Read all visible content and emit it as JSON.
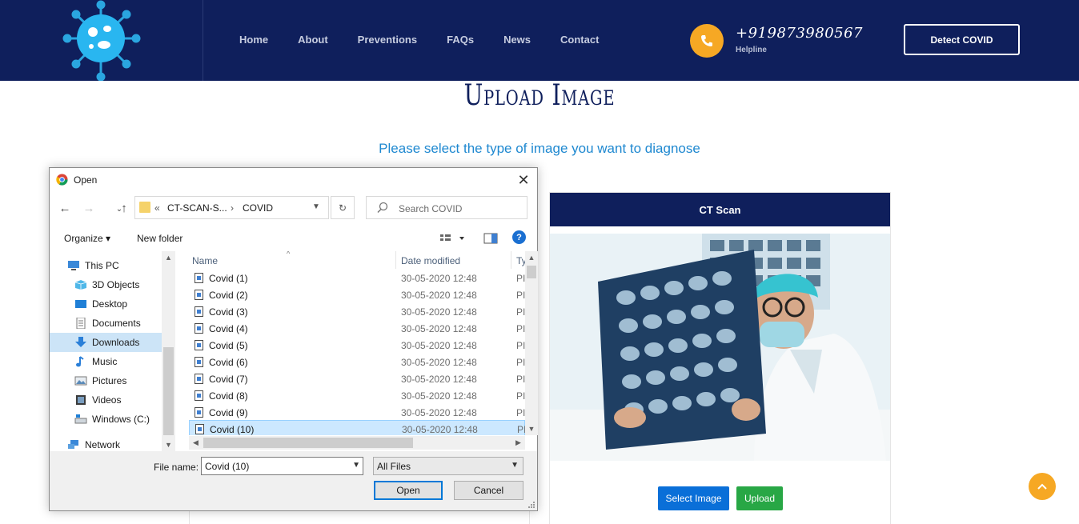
{
  "header": {
    "nav": [
      "Home",
      "About",
      "Preventions",
      "FAQs",
      "News",
      "Contact"
    ],
    "phone_number": "+919873980567",
    "phone_label": "Helpline",
    "cta_label": "Detect COVID"
  },
  "main": {
    "title": "Upload Image",
    "subtitle": "Please select the type of image you want to diagnose",
    "ct_card": {
      "title": "CT Scan",
      "select_label": "Select Image",
      "upload_label": "Upload"
    }
  },
  "dialog": {
    "title": "Open",
    "path": [
      "CT-SCAN-S...",
      "COVID"
    ],
    "path_prefix": "«",
    "search_placeholder": "Search COVID",
    "toolbar": {
      "organize": "Organize ▾",
      "new_folder": "New folder"
    },
    "nav_pane": [
      {
        "label": "This PC",
        "icon": "pc-icon",
        "indent": false,
        "selected": false
      },
      {
        "label": "3D Objects",
        "icon": "3d-objects-icon",
        "indent": true,
        "selected": false
      },
      {
        "label": "Desktop",
        "icon": "desktop-icon",
        "indent": true,
        "selected": false
      },
      {
        "label": "Documents",
        "icon": "documents-icon",
        "indent": true,
        "selected": false
      },
      {
        "label": "Downloads",
        "icon": "downloads-icon",
        "indent": true,
        "selected": true
      },
      {
        "label": "Music",
        "icon": "music-icon",
        "indent": true,
        "selected": false
      },
      {
        "label": "Pictures",
        "icon": "pictures-icon",
        "indent": true,
        "selected": false
      },
      {
        "label": "Videos",
        "icon": "videos-icon",
        "indent": true,
        "selected": false
      },
      {
        "label": "Windows (C:)",
        "icon": "drive-icon",
        "indent": true,
        "selected": false
      },
      {
        "label": "Network",
        "icon": "network-icon",
        "indent": false,
        "selected": false
      }
    ],
    "columns": {
      "name": "Name",
      "date": "Date modified",
      "type": "Ty"
    },
    "files": [
      {
        "name": "Covid (1)",
        "date": "30-05-2020 12:48",
        "type": "PI"
      },
      {
        "name": "Covid (2)",
        "date": "30-05-2020 12:48",
        "type": "PI"
      },
      {
        "name": "Covid (3)",
        "date": "30-05-2020 12:48",
        "type": "PI"
      },
      {
        "name": "Covid (4)",
        "date": "30-05-2020 12:48",
        "type": "PI"
      },
      {
        "name": "Covid (5)",
        "date": "30-05-2020 12:48",
        "type": "PI"
      },
      {
        "name": "Covid (6)",
        "date": "30-05-2020 12:48",
        "type": "PI"
      },
      {
        "name": "Covid (7)",
        "date": "30-05-2020 12:48",
        "type": "PI"
      },
      {
        "name": "Covid (8)",
        "date": "30-05-2020 12:48",
        "type": "PI"
      },
      {
        "name": "Covid (9)",
        "date": "30-05-2020 12:48",
        "type": "PI"
      },
      {
        "name": "Covid (10)",
        "date": "30-05-2020 12:48",
        "type": "PI",
        "selected": true
      }
    ],
    "file_name_label": "File name:",
    "file_name_value": "Covid (10)",
    "file_type_value": "All Files",
    "open_label": "Open",
    "cancel_label": "Cancel"
  },
  "colors": {
    "navy": "#0f1f5c",
    "accent_orange": "#f6a824",
    "subtitle_blue": "#1e88d0",
    "select_blue": "#0a6fd8",
    "upload_green": "#28a745"
  }
}
